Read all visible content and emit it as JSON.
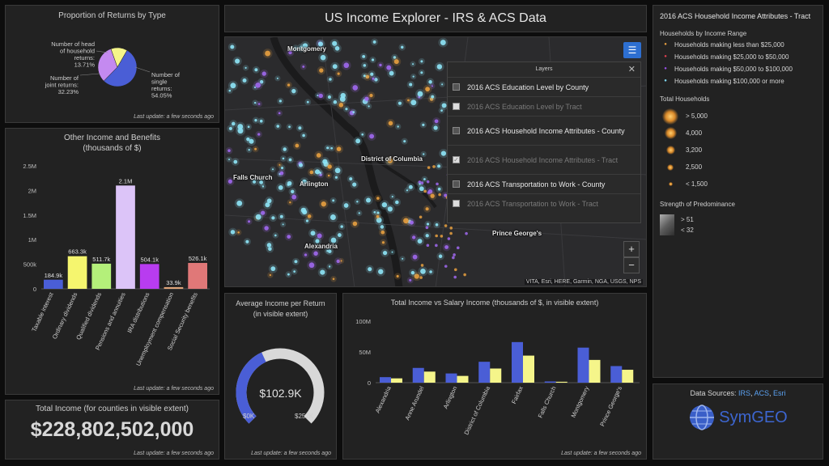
{
  "header": {
    "title": "US Income Explorer - IRS & ACS Data"
  },
  "returns_panel": {
    "title": "Proportion of Returns by Type",
    "last_update": "Last update: a few seconds ago",
    "chart_data": {
      "type": "pie",
      "categories": [
        "Number of single returns",
        "Number of joint returns",
        "Number of head of household returns"
      ],
      "values": [
        54.05,
        32.23,
        13.71
      ],
      "labels": [
        "Number of single returns: 54.05%",
        "Number of joint returns: 32.23%",
        "Number of head of household returns: 13.71%"
      ],
      "colors": [
        "#4a5ed6",
        "#c48af0",
        "#f5f58a"
      ]
    }
  },
  "other_income_panel": {
    "title": "Other Income and Benefits",
    "subtitle": "(thousands of $)",
    "last_update": "Last update: a few seconds ago",
    "chart_data": {
      "type": "bar",
      "categories": [
        "Taxable interest",
        "Ordinary dividends",
        "Qualified dividends",
        "Pensions and annuities",
        "IRA distributions",
        "Unemployment compensation",
        "Social Security benefits"
      ],
      "values": [
        184.9,
        663.3,
        511.7,
        2100,
        504.1,
        33.9,
        526.1
      ],
      "value_labels": [
        "184.9k",
        "663.3k",
        "511.7k",
        "2.1M",
        "504.1k",
        "33.9k",
        "526.1k"
      ],
      "colors": [
        "#4a5ed6",
        "#f5f56e",
        "#b4f07a",
        "#dcc4f8",
        "#b83cf0",
        "#e0a57a",
        "#e07878"
      ],
      "ylim": [
        0,
        2500
      ],
      "yticks": [
        "0",
        "500k",
        "1M",
        "1.5M",
        "2M",
        "2.5M"
      ]
    }
  },
  "total_income_panel": {
    "title": "Total Income (for counties in visible extent)",
    "value": "$228,802,502,000",
    "last_update": "Last update: a few seconds ago"
  },
  "avg_income_panel": {
    "title": "Average Income per Return",
    "subtitle": "(in visible extent)",
    "value": "$102.9K",
    "min_label": "$0K",
    "max_label": "$252K",
    "fraction": 0.408,
    "last_update": "Last update: a few seconds ago"
  },
  "salary_panel": {
    "title": "Total Income vs Salary Income (thousands of $, in visible extent)",
    "last_update": "Last update: a few seconds ago",
    "chart_data": {
      "type": "bar",
      "categories": [
        "Alexandria",
        "Anne Arundel",
        "Arlington",
        "District of Columbia",
        "Fairfax",
        "Falls Church",
        "Montgomery",
        "Prince George's"
      ],
      "series": [
        {
          "values": [
            9,
            24,
            15,
            34,
            66,
            2,
            57,
            27
          ],
          "color": "#4a5ed6"
        },
        {
          "values": [
            7,
            18,
            11,
            23,
            44,
            1.5,
            37,
            21
          ],
          "color": "#f5f58a"
        }
      ],
      "ylim": [
        0,
        100
      ],
      "yticks": [
        "0",
        "50M",
        "100M"
      ]
    }
  },
  "map": {
    "labels": [
      "Montgomery",
      "District of Columbia",
      "Falls Church",
      "Arlington",
      "Alexandria",
      "Prince George's"
    ],
    "attribution": "VITA, Esri, HERE, Garmin, NGA, USGS, NPS",
    "zoom_in": "+",
    "zoom_out": "−",
    "layers": {
      "title": "Layers",
      "close": "✕",
      "items": [
        {
          "label": "2016 ACS Education Level by County",
          "state": "on",
          "check": ""
        },
        {
          "label": "2016 ACS Education Level by Tract",
          "state": "off",
          "check": ""
        },
        {
          "label": "2016 ACS Household Income Attributes - County",
          "state": "on",
          "check": ""
        },
        {
          "label": "2016 ACS Household Income Attributes - Tract",
          "state": "off",
          "check": "✓"
        },
        {
          "label": "2016 ACS Transportation to Work - County",
          "state": "on",
          "check": ""
        },
        {
          "label": "2016 ACS Transportation to Work - Tract",
          "state": "off",
          "check": ""
        }
      ]
    }
  },
  "legend": {
    "title": "2016 ACS Household Income Attributes - Tract",
    "income_range_title": "Households by Income Range",
    "income_ranges": [
      {
        "label": "Households making less than $25,000",
        "color": "#e8a040"
      },
      {
        "label": "Households making $25,000 to $50,000",
        "color": "#e04050"
      },
      {
        "label": "Households making $50,000 to $100,000",
        "color": "#9a50e8"
      },
      {
        "label": "Households making $100,000 or more",
        "color": "#7fd8f0"
      }
    ],
    "total_title": "Total Households",
    "sizes": [
      "> 5,000",
      "4,000",
      "3,200",
      "2,500",
      "< 1,500"
    ],
    "strength_title": "Strength of Predominance",
    "strength": [
      "> 51",
      "< 32"
    ]
  },
  "sources": {
    "prefix": "Data Sources: ",
    "links": [
      "IRS",
      "ACS",
      "Esri"
    ],
    "brand": "SymGEO"
  }
}
